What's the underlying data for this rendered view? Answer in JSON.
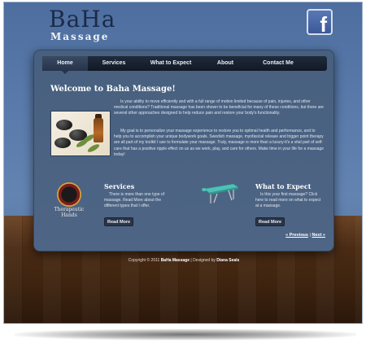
{
  "brand": {
    "name": "BaHa",
    "tagline": "Massage"
  },
  "social": {
    "facebook_glyph": "f"
  },
  "nav": {
    "items": [
      {
        "label": "Home",
        "active": true
      },
      {
        "label": "Services",
        "active": false
      },
      {
        "label": "What to Expect",
        "active": false
      },
      {
        "label": "About",
        "active": false
      },
      {
        "label": "Contact Me",
        "active": false
      }
    ]
  },
  "welcome": {
    "title": "Welcome to Baha Massage!",
    "p1": "Is your ability to move efficiently and with a full range of motion limited because of pain, injuries, and other medical conditions? Traditional massage has been shown to be beneficial for many of these conditions, but there are several other approaches designed to help reduce pain and restore your body's functionality.",
    "p2": "My goal is to personalize your massage experience to restore you to optimal health and performance, and to help you to accomplish your unique bodywork goals. Swedish massage, myofascial release and trigger point therapy are all part of my toolkit I use to formulate your massage. Truly, massage is more than a luxury-it's a vital part of self-care that has a positive ripple effect on us as we work, play, and care for others. Make time in your life for a massage today!"
  },
  "services": {
    "logo_text": "Therapeutic Hands",
    "title": "Services",
    "text": "There is more than one type of massage. Read More about the different types that I offer.",
    "button": "Read More"
  },
  "expect": {
    "title": "What to Expect",
    "text": "Is this your first massage? Click here to read more on what to expect at a massage.",
    "button": "Read More"
  },
  "pager": {
    "prev": "« Previous",
    "separator": "|",
    "next": "Next »"
  },
  "footer": {
    "prefix": "Copyright © 2011",
    "site": "BaHa Massage",
    "middle": "| Designed by",
    "designer": "Diana Seals"
  },
  "colors": {
    "background": "#5a7bab",
    "panel": "#4b6283",
    "nav": "#151d2a",
    "floor": "#4a2b14",
    "facebook": "#3b5998"
  }
}
